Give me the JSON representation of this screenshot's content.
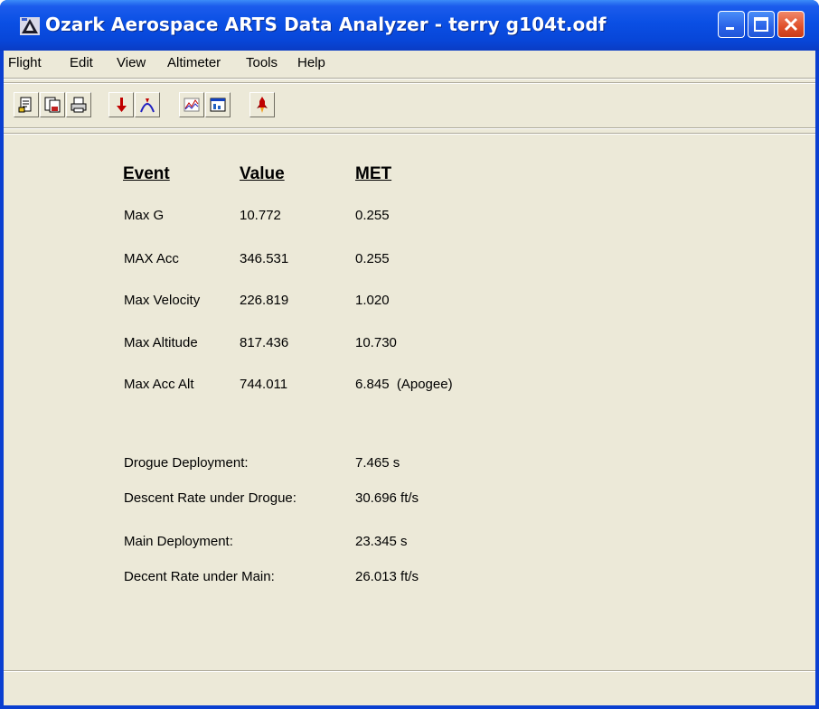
{
  "window": {
    "title": "Ozark Aerospace ARTS Data Analyzer - terry g104t.odf"
  },
  "menu": [
    "Flight",
    "Edit",
    "View",
    "Altimeter",
    "Tools",
    "Help"
  ],
  "toolbar": [
    {
      "icon": "open-document-icon"
    },
    {
      "icon": "save-document-icon"
    },
    {
      "icon": "print-icon"
    },
    {
      "icon": "download-arrow-icon"
    },
    {
      "icon": "flight-path-icon"
    },
    {
      "icon": "line-graph-icon"
    },
    {
      "icon": "window-chart-icon"
    },
    {
      "icon": "rocket-icon"
    }
  ],
  "table": {
    "headers": {
      "event": "Event",
      "value": "Value",
      "met": "MET"
    },
    "rows": [
      {
        "event": "Max G",
        "value": "10.772",
        "met": "0.255"
      },
      {
        "event": "MAX Acc",
        "value": "346.531",
        "met": "0.255"
      },
      {
        "event": "Max Velocity",
        "value": "226.819",
        "met": "1.020"
      },
      {
        "event": "Max Altitude",
        "value": "817.436",
        "met": "10.730"
      },
      {
        "event": "Max Acc Alt",
        "value": "744.011",
        "met": "6.845  (Apogee)"
      }
    ]
  },
  "deployments": [
    {
      "label": "Drogue Deployment:",
      "value": "7.465 s"
    },
    {
      "label": "Descent Rate under Drogue:",
      "value": "30.696 ft/s"
    },
    {
      "label": "Main Deployment:",
      "value": "23.345 s"
    },
    {
      "label": "Decent Rate under Main:",
      "value": "26.013 ft/s"
    }
  ],
  "colors": {
    "titlebar": "#0a4fe4",
    "background": "#ece9d8",
    "close_button": "#e0502a"
  }
}
